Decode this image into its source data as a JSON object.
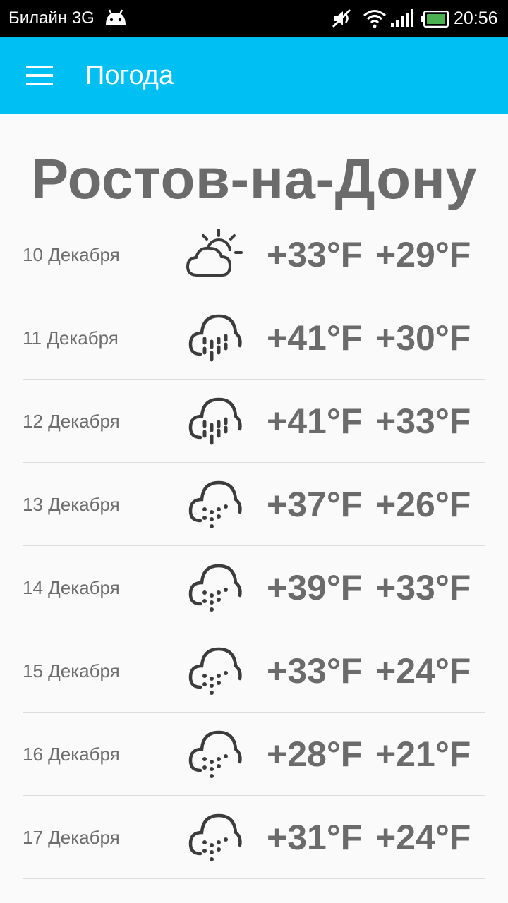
{
  "status_bar": {
    "carrier": "Билайн 3G",
    "time": "20:56",
    "icons": [
      "android-icon",
      "mute-icon",
      "wifi-icon",
      "signal-icon",
      "battery-icon"
    ],
    "battery_color": "#4caf50"
  },
  "app_bar": {
    "title": "Погода",
    "color": "#00bff3",
    "menu_icon": "hamburger-menu-icon"
  },
  "city": "Ростов-на-Дону",
  "forecast": [
    {
      "date": "10 Декабря",
      "icon": "partly-cloudy-icon",
      "high": "+33°F",
      "low": "+29°F"
    },
    {
      "date": "11 Декабря",
      "icon": "rain-icon",
      "high": "+41°F",
      "low": "+30°F"
    },
    {
      "date": "12 Декабря",
      "icon": "rain-icon",
      "high": "+41°F",
      "low": "+33°F"
    },
    {
      "date": "13 Декабря",
      "icon": "snow-icon",
      "high": "+37°F",
      "low": "+26°F"
    },
    {
      "date": "14 Декабря",
      "icon": "snow-icon",
      "high": "+39°F",
      "low": "+33°F"
    },
    {
      "date": "15 Декабря",
      "icon": "snow-icon",
      "high": "+33°F",
      "low": "+24°F"
    },
    {
      "date": "16 Декабря",
      "icon": "snow-icon",
      "high": "+28°F",
      "low": "+21°F"
    },
    {
      "date": "17 Декабря",
      "icon": "snow-icon",
      "high": "+31°F",
      "low": "+24°F"
    }
  ]
}
